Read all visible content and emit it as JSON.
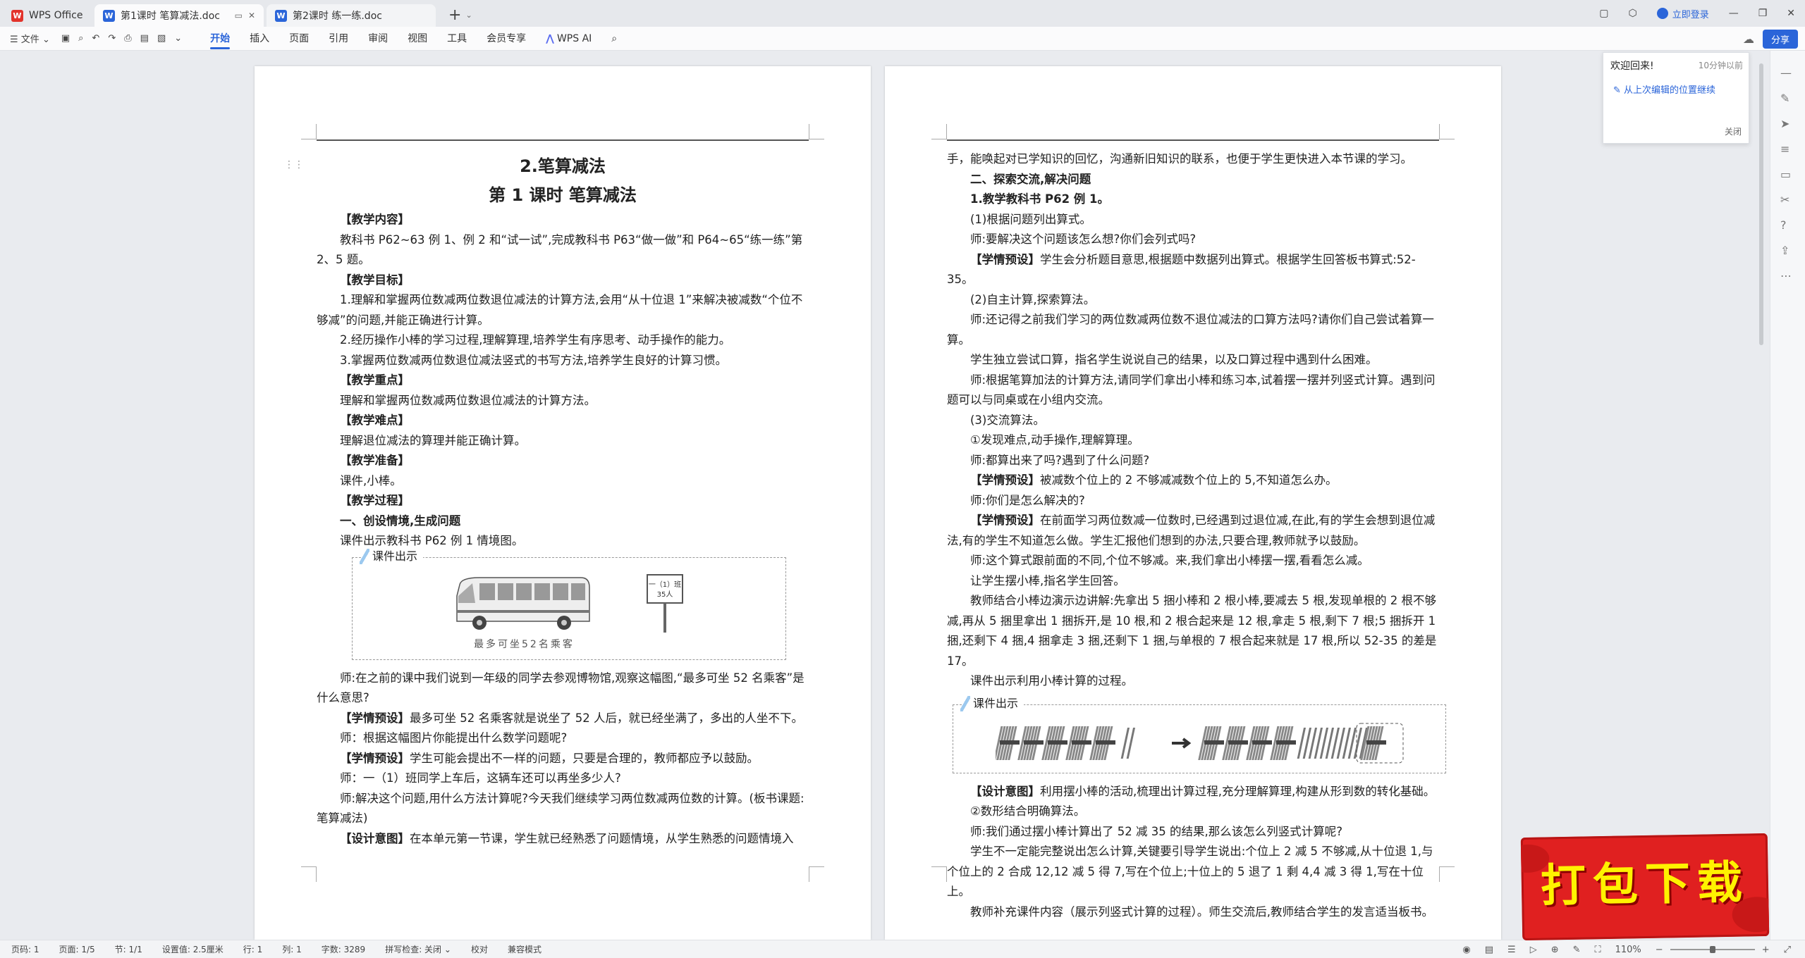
{
  "titlebar": {
    "home_tab": "WPS Office",
    "tabs": [
      {
        "label": "第1课时  笔算减法.doc"
      },
      {
        "label": "第2课时  练一练.doc"
      }
    ],
    "login": "立即登录"
  },
  "toolbar": {
    "file_menu": "文件",
    "menus": [
      "开始",
      "插入",
      "页面",
      "引用",
      "审阅",
      "视图",
      "工具",
      "会员专享"
    ],
    "wps_ai": "WPS AI",
    "share": "分享"
  },
  "page1": {
    "title": "2.笔算减法",
    "subtitle": "第 1 课时    笔算减法",
    "paragraphs": [
      {
        "bold": "【教学内容】",
        "text": ""
      },
      {
        "bold": "",
        "text": "教科书 P62~63 例 1、例 2 和“试一试”,完成教科书 P63“做一做”和 P64~65“练一练”第 2、5 题。"
      },
      {
        "bold": "【教学目标】",
        "text": ""
      },
      {
        "bold": "",
        "text": "1.理解和掌握两位数减两位数退位减法的计算方法,会用“从十位退 1”来解决被减数“个位不够减”的问题,并能正确进行计算。"
      },
      {
        "bold": "",
        "text": "2.经历操作小棒的学习过程,理解算理,培养学生有序思考、动手操作的能力。"
      },
      {
        "bold": "",
        "text": "3.掌握两位数减两位数退位减法竖式的书写方法,培养学生良好的计算习惯。"
      },
      {
        "bold": "【教学重点】",
        "text": ""
      },
      {
        "bold": "",
        "text": "理解和掌握两位数减两位数退位减法的计算方法。"
      },
      {
        "bold": "【教学难点】",
        "text": ""
      },
      {
        "bold": "",
        "text": "理解退位减法的算理并能正确计算。"
      },
      {
        "bold": "【教学准备】",
        "text": ""
      },
      {
        "bold": "",
        "text": "课件,小棒。"
      },
      {
        "bold": "【教学过程】",
        "text": ""
      },
      {
        "bold": "一、创设情境,生成问题",
        "text": ""
      },
      {
        "bold": "",
        "text": "课件出示教科书 P62 例 1 情境图。"
      }
    ],
    "figure_label": "课件出示",
    "figure_caption": "最多可坐52名乘客",
    "sign_text": "一（1）班 35人",
    "paragraphs2": [
      {
        "bold": "",
        "text": "师:在之前的课中我们说到一年级的同学去参观博物馆,观察这幅图,“最多可坐 52 名乘客”是什么意思?"
      },
      {
        "bold": "【学情预设】",
        "text": "最多可坐 52 名乘客就是说坐了 52 人后，就已经坐满了，多出的人坐不下。"
      },
      {
        "bold": "",
        "text": "师：根据这幅图片你能提出什么数学问题呢?"
      },
      {
        "bold": "【学情预设】",
        "text": "学生可能会提出不一样的问题，只要是合理的，教师都应予以鼓励。"
      },
      {
        "bold": "",
        "text": "师：一（1）班同学上车后，这辆车还可以再坐多少人?"
      },
      {
        "bold": "",
        "text": "师:解决这个问题,用什么方法计算呢?今天我们继续学习两位数减两位数的计算。(板书课题:笔算减法)"
      },
      {
        "bold": "【设计意图】",
        "text": "在本单元第一节课，学生就已经熟悉了问题情境，从学生熟悉的问题情境入"
      }
    ]
  },
  "page2": {
    "paragraphs": [
      {
        "bold": "",
        "text": "手，能唤起对已学知识的回忆，沟通新旧知识的联系，也便于学生更快进入本节课的学习。",
        "noindent": true
      },
      {
        "bold": "二、探索交流,解决问题",
        "text": ""
      },
      {
        "bold": "1.教学教科书 P62 例 1。",
        "text": ""
      },
      {
        "bold": "",
        "text": "(1)根据问题列出算式。"
      },
      {
        "bold": "",
        "text": "师:要解决这个问题该怎么想?你们会列式吗?"
      },
      {
        "bold": "【学情预设】",
        "text": "学生会分析题目意思,根据题中数据列出算式。根据学生回答板书算式:52-35。"
      },
      {
        "bold": "",
        "text": "(2)自主计算,探索算法。"
      },
      {
        "bold": "",
        "text": "师:还记得之前我们学习的两位数减两位数不退位减法的口算方法吗?请你们自己尝试着算一算。"
      },
      {
        "bold": "",
        "text": "学生独立尝试口算，指名学生说说自己的结果，以及口算过程中遇到什么困难。"
      },
      {
        "bold": "",
        "text": "师:根据笔算加法的计算方法,请同学们拿出小棒和练习本,试着摆一摆并列竖式计算。遇到问题可以与同桌或在小组内交流。"
      },
      {
        "bold": "",
        "text": "(3)交流算法。"
      },
      {
        "bold": "",
        "text": "①发现难点,动手操作,理解算理。"
      },
      {
        "bold": "",
        "text": "师:都算出来了吗?遇到了什么问题?"
      },
      {
        "bold": "【学情预设】",
        "text": "被减数个位上的 2 不够减减数个位上的 5,不知道怎么办。"
      },
      {
        "bold": "",
        "text": "师:你们是怎么解决的?"
      },
      {
        "bold": "【学情预设】",
        "text": "在前面学习两位数减一位数时,已经遇到过退位减,在此,有的学生会想到退位减法,有的学生不知道怎么做。学生汇报他们想到的办法,只要合理,教师就予以鼓励。"
      },
      {
        "bold": "",
        "text": "师:这个算式跟前面的不同,个位不够减。来,我们拿出小棒摆一摆,看看怎么减。"
      },
      {
        "bold": "",
        "text": "让学生摆小棒,指名学生回答。"
      },
      {
        "bold": "",
        "text": "教师结合小棒边演示边讲解:先拿出 5 捆小棒和 2 根小棒,要减去 5 根,发现单根的 2 根不够减,再从 5 捆里拿出 1 捆拆开,是 10 根,和 2 根合起来是 12 根,拿走 5 根,剩下 7 根;5 捆拆开 1 捆,还剩下 4 捆,4 捆拿走 3 捆,还剩下 1 捆,与单根的 7 根合起来就是 17 根,所以 52-35 的差是 17。"
      },
      {
        "bold": "",
        "text": "课件出示利用小棒计算的过程。"
      }
    ],
    "figure_label": "课件出示",
    "paragraphs2": [
      {
        "bold": "【设计意图】",
        "text": "利用摆小棒的活动,梳理出计算过程,充分理解算理,构建从形到数的转化基础。"
      },
      {
        "bold": "",
        "text": "②数形结合明确算法。"
      },
      {
        "bold": "",
        "text": "师:我们通过摆小棒计算出了 52 减 35 的结果,那么该怎么列竖式计算呢?"
      },
      {
        "bold": "",
        "text": "学生不一定能完整说出怎么计算,关键要引导学生说出:个位上 2 减 5 不够减,从十位退 1,与个位上的 2 合成 12,12 减 5 得 7,写在个位上;十位上的 5 退了 1 剩 4,4 减 3 得 1,写在十位上。"
      },
      {
        "bold": "",
        "text": "教师补充课件内容（展示列竖式计算的过程）。师生交流后,教师结合学生的发言适当板书。"
      }
    ]
  },
  "popup": {
    "title": "欢迎回来!",
    "time": "10分钟以前",
    "link": "从上次编辑的位置继续",
    "close": "关闭"
  },
  "statusbar": {
    "items": [
      "页码: 1",
      "页面: 1/5",
      "节: 1/1",
      "设置值: 2.5厘米",
      "行: 1",
      "列: 1",
      "字数: 3289",
      "拼写检查: 关闭 ⌄",
      "校对",
      "兼容模式"
    ],
    "zoom": "110%"
  },
  "banner": {
    "text": "打包下载"
  },
  "colors": {
    "accent": "#2b65d9",
    "banner_bg": "#e02020",
    "banner_text": "#fff200"
  }
}
